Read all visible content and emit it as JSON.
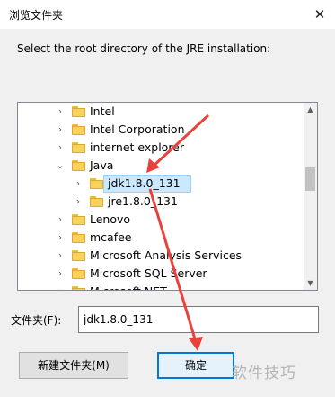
{
  "window": {
    "title": "浏览文件夹",
    "close_glyph": "✕"
  },
  "instruction": "Select the root directory of the JRE installation:",
  "tree": {
    "items": [
      {
        "label": "Intel",
        "expanded": false,
        "selected": false
      },
      {
        "label": "Intel Corporation",
        "expanded": false,
        "selected": false
      },
      {
        "label": "internet explorer",
        "expanded": false,
        "selected": false
      },
      {
        "label": "Java",
        "expanded": true,
        "selected": false
      },
      {
        "label": "jdk1.8.0_131",
        "expanded": false,
        "selected": true
      },
      {
        "label": "jre1.8.0_131",
        "expanded": false,
        "selected": false
      },
      {
        "label": "Lenovo",
        "expanded": false,
        "selected": false
      },
      {
        "label": "mcafee",
        "expanded": false,
        "selected": false
      },
      {
        "label": "Microsoft Analysis Services",
        "expanded": false,
        "selected": false
      },
      {
        "label": "Microsoft SQL Server",
        "expanded": false,
        "selected": false
      },
      {
        "label": "Microsoft.NET",
        "expanded": false,
        "selected": false
      }
    ]
  },
  "folder_field": {
    "label": "文件夹(F):",
    "value": "jdk1.8.0_131"
  },
  "buttons": {
    "new_folder": "新建文件夹(M)",
    "ok": "确定"
  },
  "watermark": "软件技巧",
  "colors": {
    "selection": "#cce8ff",
    "annotation_arrow": "#e8423a",
    "default_button_border": "#0078d7"
  }
}
